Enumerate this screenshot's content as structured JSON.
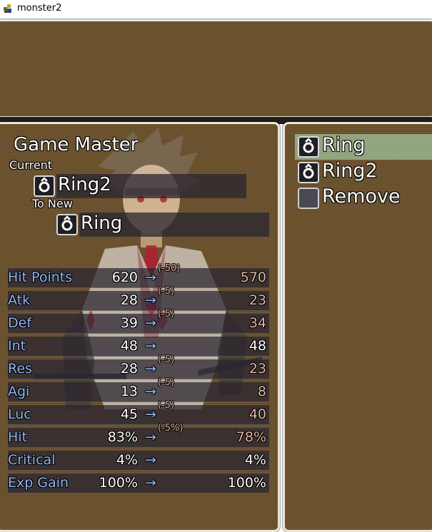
{
  "window": {
    "title": "monster2"
  },
  "actor": {
    "name": "Game Master",
    "current_label": "Current",
    "to_new_label": "To New",
    "current_equip": "Ring2",
    "new_equip": "Ring"
  },
  "stats": [
    {
      "name": "Hit Points",
      "current": "620",
      "arrow": "→",
      "diff": "(-50)",
      "new": "570",
      "down": true
    },
    {
      "name": "Atk",
      "current": "28",
      "arrow": "→",
      "diff": "(-5)",
      "new": "23",
      "down": true
    },
    {
      "name": "Def",
      "current": "39",
      "arrow": "→",
      "diff": "(-5)",
      "new": "34",
      "down": true
    },
    {
      "name": "Int",
      "current": "48",
      "arrow": "→",
      "diff": "",
      "new": "48",
      "down": false
    },
    {
      "name": "Res",
      "current": "28",
      "arrow": "→",
      "diff": "(-5)",
      "new": "23",
      "down": true
    },
    {
      "name": "Agi",
      "current": "13",
      "arrow": "→",
      "diff": "(-5)",
      "new": "8",
      "down": true
    },
    {
      "name": "Luc",
      "current": "45",
      "arrow": "→",
      "diff": "(-5)",
      "new": "40",
      "down": true
    },
    {
      "name": "Hit",
      "current": "83%",
      "arrow": "→",
      "diff": "(-5%)",
      "new": "78%",
      "down": true
    },
    {
      "name": "Critical",
      "current": "4%",
      "arrow": "→",
      "diff": "",
      "new": "4%",
      "down": false
    },
    {
      "name": "Exp Gain",
      "current": "100%",
      "arrow": "→",
      "diff": "",
      "new": "100%",
      "down": false
    }
  ],
  "item_list": [
    {
      "name": "Ring",
      "icon": "ring-icon",
      "selected": true
    },
    {
      "name": "Ring2",
      "icon": "ring-icon",
      "selected": false
    },
    {
      "name": "Remove",
      "icon": "blank-icon",
      "selected": false
    }
  ],
  "colors": {
    "window_bg": "#6e5530",
    "window_border": "#e9e6dc",
    "stat_label": "#8fb6f2",
    "decrease": "#e3b6a6",
    "selection": "#9ebc96"
  }
}
